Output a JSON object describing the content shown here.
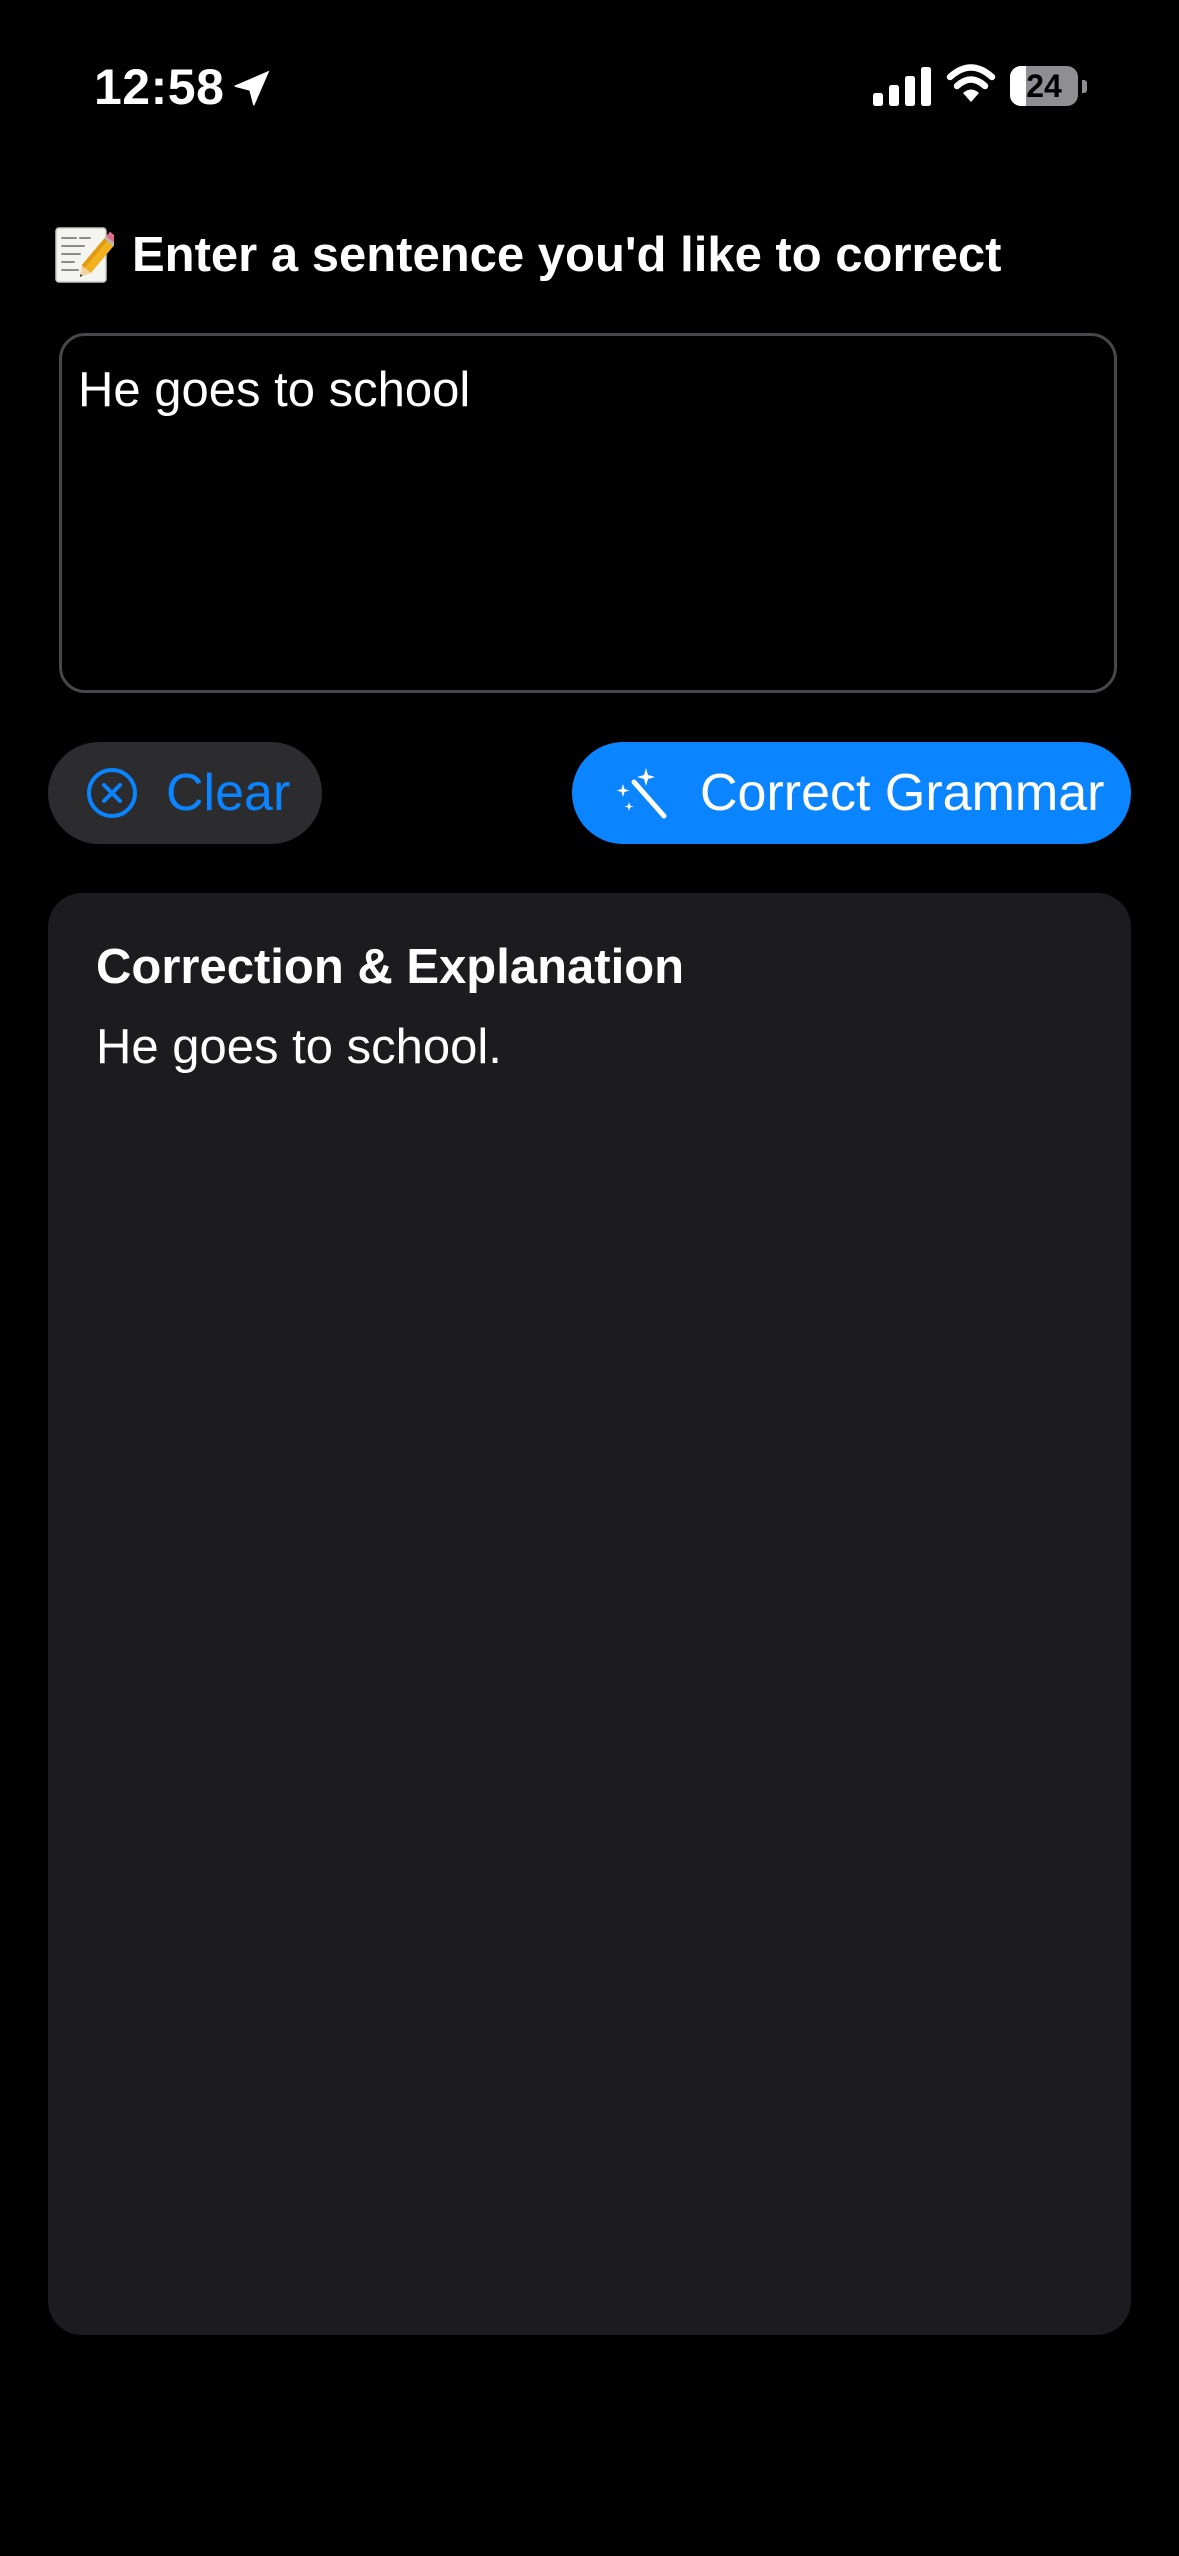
{
  "status_bar": {
    "time": "12:58",
    "battery": "24",
    "battery_level": 0.24
  },
  "prompt": {
    "icon": "memo-icon",
    "text": "Enter a sentence you'd like to correct"
  },
  "input": {
    "value": "He goes to school"
  },
  "buttons": {
    "clear_icon": "circle-x-icon",
    "clear_label": "Clear",
    "correct_icon": "magic-wand-icon",
    "correct_label": "Correct Grammar"
  },
  "result": {
    "title": "Correction & Explanation",
    "text": "He goes to school."
  },
  "colors": {
    "accent": "#0a84ff",
    "background": "#000000",
    "card": "#1c1c1e",
    "button_secondary": "#2c2c2e"
  }
}
